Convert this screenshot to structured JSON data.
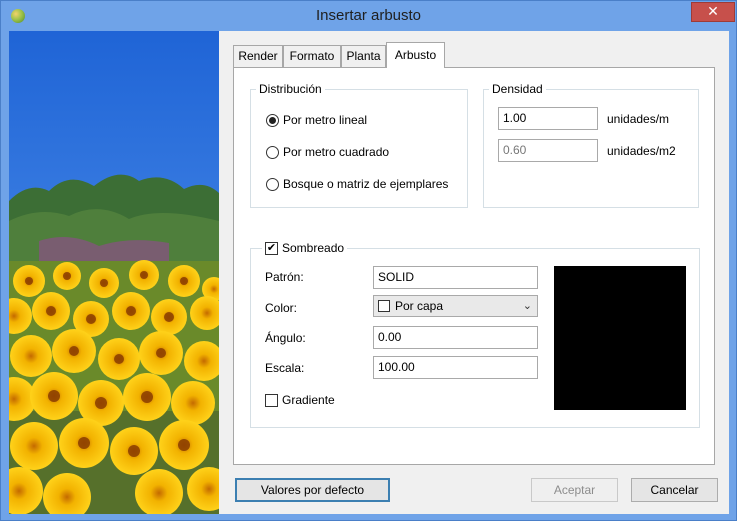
{
  "window": {
    "title": "Insertar arbusto",
    "close_glyph": "✕",
    "icon": "app-plant-icon"
  },
  "tabs": [
    {
      "label": "Render"
    },
    {
      "label": "Formato"
    },
    {
      "label": "Planta"
    },
    {
      "label": "Arbusto",
      "active": true
    }
  ],
  "distribucion": {
    "legend": "Distribución",
    "options": [
      {
        "label": "Por metro lineal",
        "selected": true
      },
      {
        "label": "Por metro cuadrado",
        "selected": false
      },
      {
        "label": "Bosque o matriz de ejemplares",
        "selected": false
      }
    ]
  },
  "densidad": {
    "legend": "Densidad",
    "linear_value": "1.00",
    "linear_unit": "unidades/m",
    "area_value": "0.60",
    "area_unit": "unidades/m2"
  },
  "sombreado": {
    "label": "Sombreado",
    "check_glyph": "✔",
    "checked": true,
    "patron_label": "Patrón:",
    "patron_value": "SOLID",
    "color_label": "Color:",
    "color_value": "Por capa",
    "angulo_label": "Ángulo:",
    "angulo_value": "0.00",
    "escala_label": "Escala:",
    "escala_value": "100.00",
    "gradiente_label": "Gradiente",
    "gradiente_checked": false,
    "preview_color": "#000000"
  },
  "buttons": {
    "defaults": "Valores por defecto",
    "accept": "Aceptar",
    "cancel": "Cancelar"
  }
}
